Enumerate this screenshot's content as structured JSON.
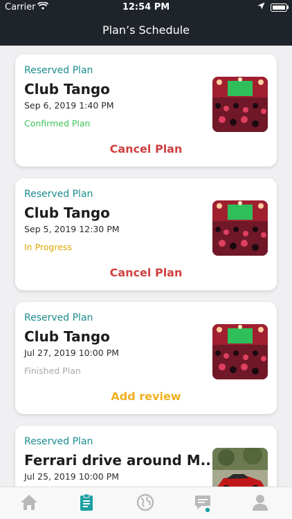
{
  "status_bar": {
    "carrier": "Carrier",
    "time": "12:54 PM"
  },
  "nav": {
    "title": "Plan’s Schedule"
  },
  "colors": {
    "teal": "#1a8c8f",
    "cancel": "#d04040",
    "review": "#f0b020",
    "confirmed": "#3cc45a",
    "in_progress": "#e0a800",
    "finished": "#a8a8a8",
    "header_bg": "#1f242b"
  },
  "plans": [
    {
      "reserved_label": "Reserved Plan",
      "name": "Club Tango",
      "date": "Sep 6, 2019 1:40 PM",
      "status": "Confirmed Plan",
      "action": "Cancel Plan",
      "image": "club-tango-photo"
    },
    {
      "reserved_label": "Reserved Plan",
      "name": "Club Tango",
      "date": "Sep 5, 2019 12:30 PM",
      "status": "In Progress",
      "action": "Cancel Plan",
      "image": "club-tango-photo"
    },
    {
      "reserved_label": "Reserved Plan",
      "name": "Club Tango",
      "date": "Jul 27, 2019 10:00 PM",
      "status": "Finished Plan",
      "action": "Add review",
      "image": "club-tango-photo"
    },
    {
      "reserved_label": "Reserved Plan",
      "name": "Ferrari drive around M...",
      "date": "Jul 25, 2019 10:00 PM",
      "image": "ferrari-photo"
    }
  ],
  "tabs": [
    {
      "icon": "home-icon",
      "active": false
    },
    {
      "icon": "clipboard-icon",
      "active": true
    },
    {
      "icon": "globe-icon",
      "active": false
    },
    {
      "icon": "chat-icon",
      "active": false,
      "badge": true
    },
    {
      "icon": "profile-icon",
      "active": false
    }
  ]
}
